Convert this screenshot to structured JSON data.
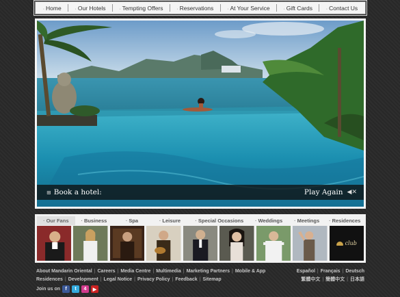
{
  "nav": {
    "items": [
      {
        "label": "Home"
      },
      {
        "label": "Our Hotels"
      },
      {
        "label": "Tempting Offers"
      },
      {
        "label": "Reservations"
      },
      {
        "label": "At Your Service"
      },
      {
        "label": "Gift Cards"
      },
      {
        "label": "Contact Us"
      }
    ]
  },
  "hero": {
    "book_label": "Book a hotel:",
    "play_label": "Play Again"
  },
  "categories": {
    "tabs": [
      {
        "label": "Our Fans"
      },
      {
        "label": "Business"
      },
      {
        "label": "Spa"
      },
      {
        "label": "Leisure"
      },
      {
        "label": "Special Occasions"
      },
      {
        "label": "Weddings"
      },
      {
        "label": "Meetings"
      },
      {
        "label": "Residences"
      }
    ],
    "club_text": "club"
  },
  "footer": {
    "row1": [
      "About Mandarin Oriental",
      "Careers",
      "Media Centre",
      "Multimedia",
      "Marketing Partners",
      "Mobile & App"
    ],
    "row2": [
      "Residences",
      "Development",
      "Legal Notice",
      "Privacy Policy",
      "Feedback",
      "Sitemap"
    ],
    "lang_row1": [
      "Español",
      "Français",
      "Deutsch"
    ],
    "lang_row2": [
      "繁體中文",
      "簡體中文",
      "日本語"
    ],
    "join_label": "Join us on",
    "social": [
      {
        "icon": "facebook-icon",
        "glyph": "f",
        "color": "#3b5998"
      },
      {
        "icon": "twitter-icon",
        "glyph": "t",
        "color": "#33aadd"
      },
      {
        "icon": "foursquare-icon",
        "glyph": "4",
        "color": "#d23a8d"
      },
      {
        "icon": "youtube-icon",
        "glyph": "▶",
        "color": "#cc2222"
      }
    ]
  },
  "colors": {
    "background": "#2b2b2b",
    "nav_bg": "#f4f4f4",
    "footer_text": "#c8c8c8",
    "club_gold": "#c9a24a"
  }
}
